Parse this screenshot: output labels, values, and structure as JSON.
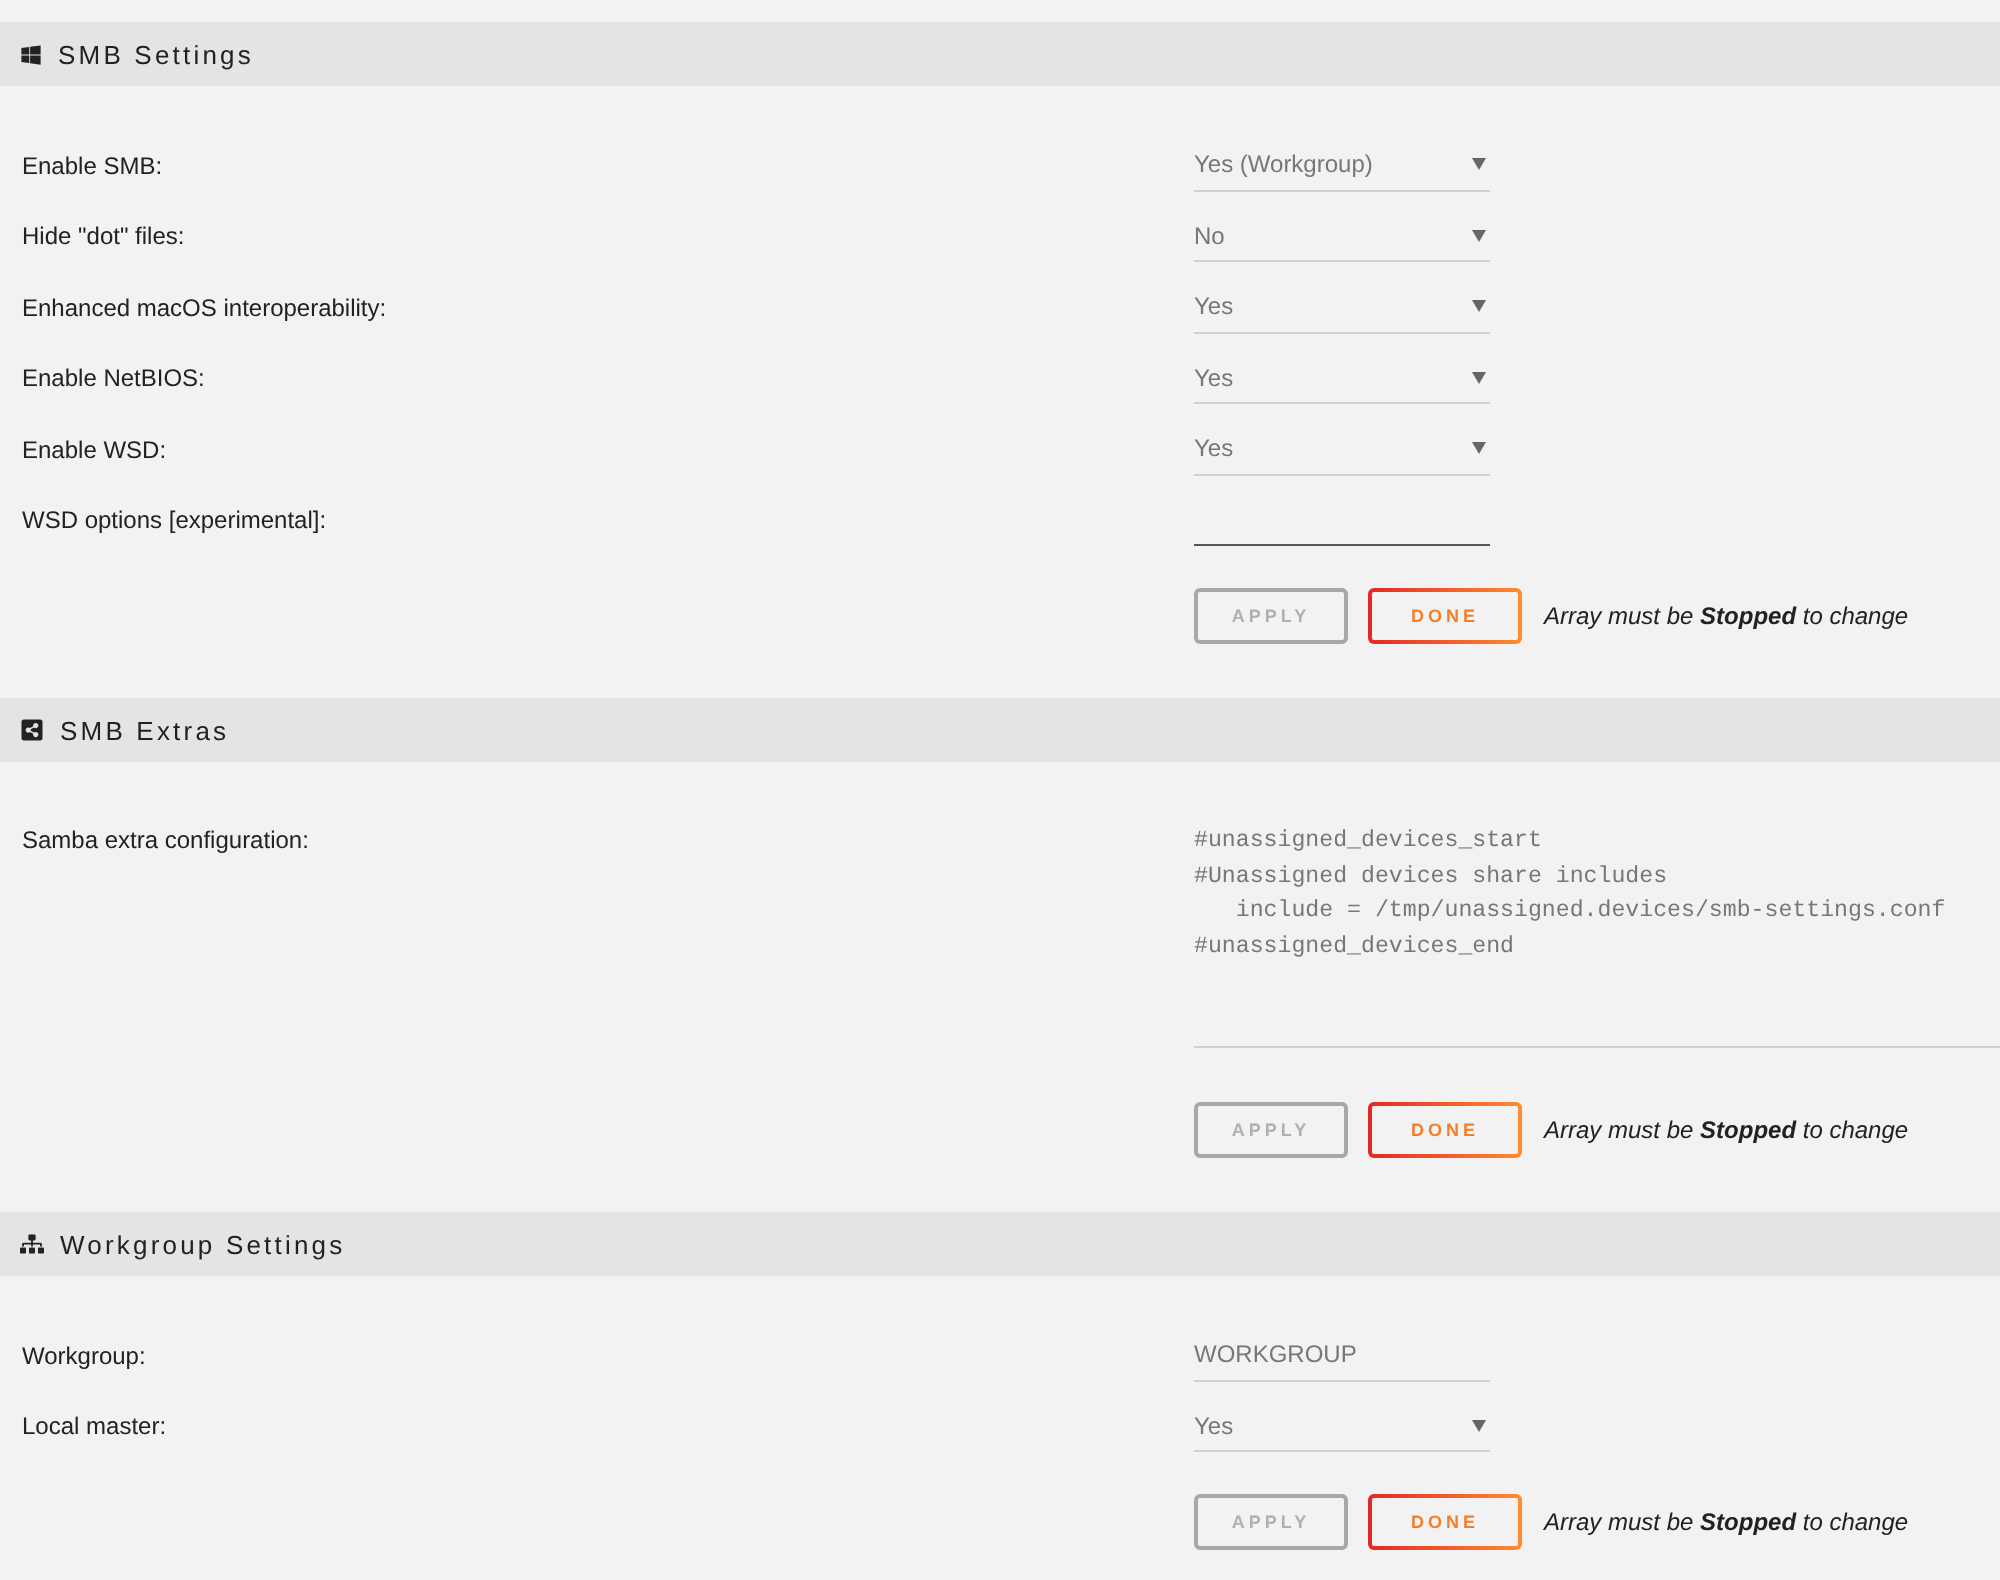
{
  "sections": [
    {
      "kind": "smb",
      "title": "SMB Settings",
      "fields": [
        {
          "kind": "select",
          "label": "Enable SMB:",
          "value": "Yes (Workgroup)"
        },
        {
          "kind": "select",
          "label": "Hide \"dot\" files:",
          "value": "No"
        },
        {
          "kind": "select",
          "label": "Enhanced macOS interoperability:",
          "value": "Yes"
        },
        {
          "kind": "select",
          "label": "Enable NetBIOS:",
          "value": "Yes"
        },
        {
          "kind": "select",
          "label": "Enable WSD:",
          "value": "Yes"
        },
        {
          "kind": "input",
          "label": "WSD options [experimental]:"
        }
      ],
      "buttons": [
        {
          "kind": "apply",
          "label": "APPLY",
          "disabled": true
        },
        {
          "kind": "done",
          "label": "DONE",
          "disabled": false
        }
      ],
      "note": "Array must be **Stopped** to change"
    },
    {
      "kind": "extras",
      "title": "SMB Extras",
      "fields": [
        {
          "kind": "textarea",
          "label": "Samba extra configuration:",
          "value": "#unassigned_devices_start\n#Unassigned devices share includes\n   include = /tmp/unassigned.devices/smb-settings.conf\n#unassigned_devices_end"
        }
      ],
      "buttons": [
        {
          "kind": "apply",
          "label": "APPLY",
          "disabled": true
        },
        {
          "kind": "done",
          "label": "DONE",
          "disabled": false
        }
      ],
      "note": "Array must be **Stopped** to change"
    },
    {
      "kind": "workgroup",
      "title": "Workgroup Settings",
      "fields": [
        {
          "kind": "input",
          "label": "Workgroup:",
          "value": "WORKGROUP"
        },
        {
          "kind": "select",
          "label": "Local master:",
          "value": "Yes"
        }
      ],
      "buttons": [
        {
          "kind": "apply",
          "label": "APPLY",
          "disabled": true
        },
        {
          "kind": "done",
          "label": "DONE",
          "disabled": false
        }
      ],
      "note": "Array must be **Stopped** to change"
    }
  ]
}
